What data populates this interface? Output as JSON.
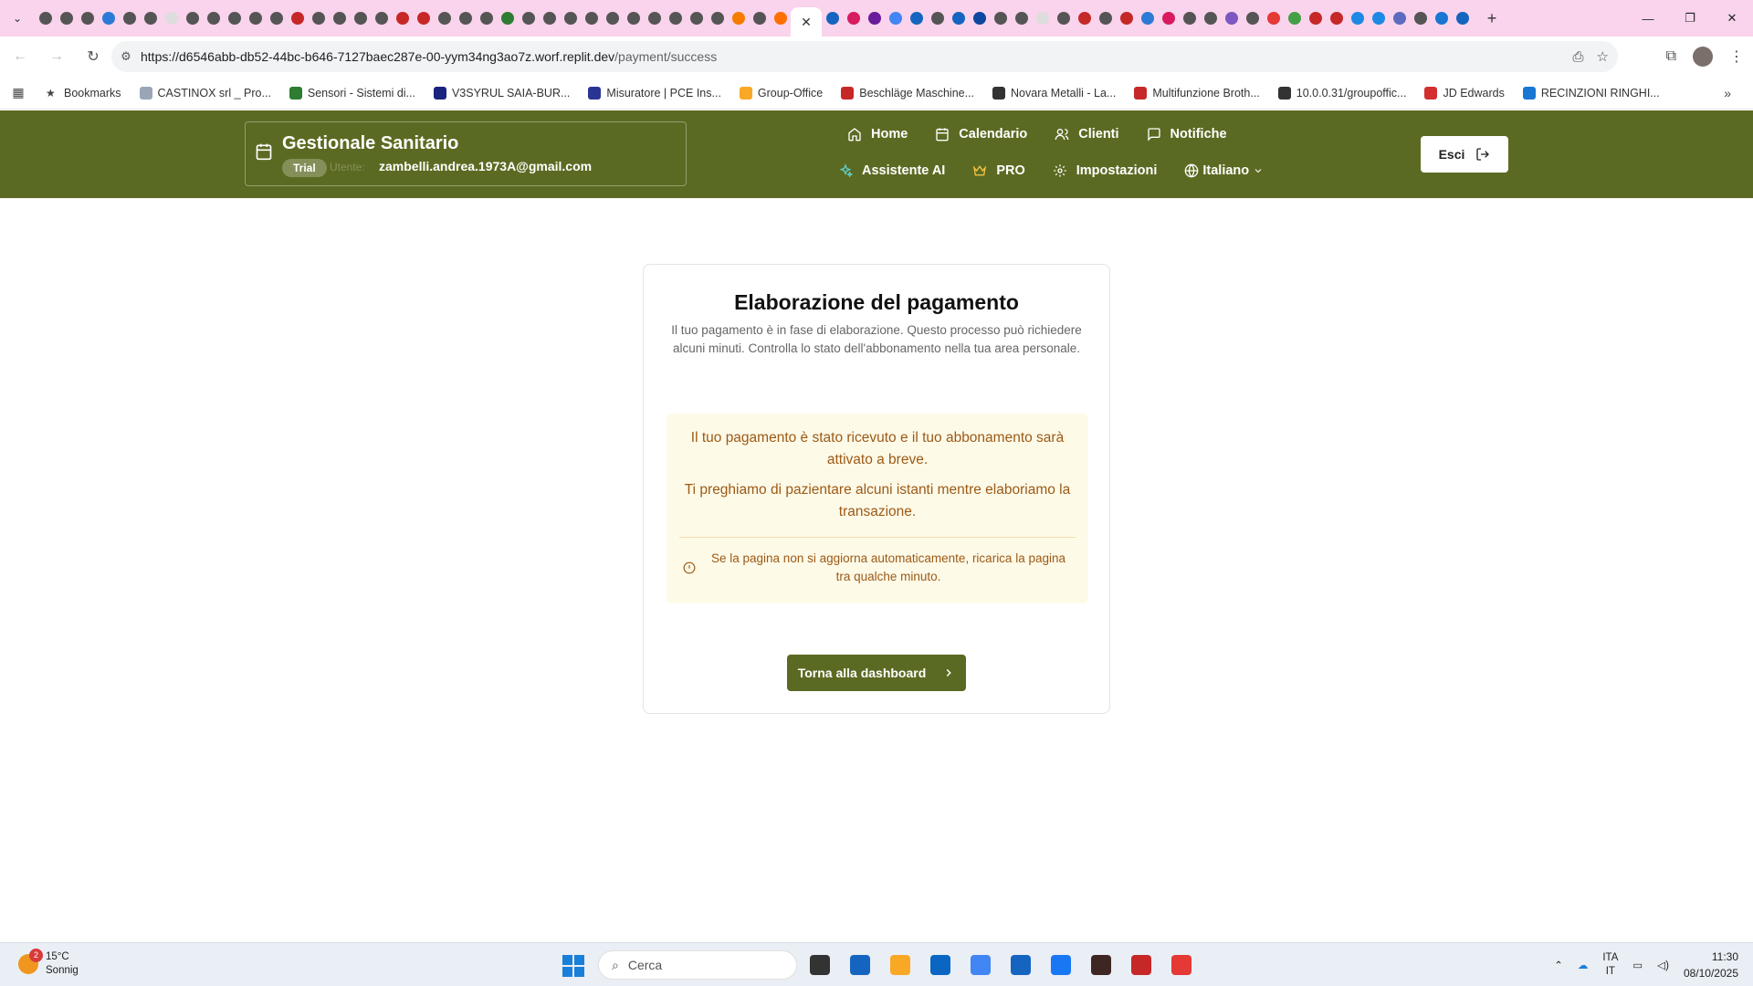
{
  "browser": {
    "tab_close_glyph": "✕",
    "new_tab_glyph": "+",
    "url_host": "https://d6546abb-db52-44bc-b646-7127baec287e-00-yym34ng3ao7z.worf.replit.dev",
    "url_path": "/payment/success",
    "tab_favicon_colors": [
      "#555",
      "#555",
      "#555",
      "#2b7bd6",
      "#555",
      "#555",
      "#ddd",
      "#555",
      "#555",
      "#555",
      "#555",
      "#555",
      "#c62828",
      "#555",
      "#555",
      "#555",
      "#555",
      "#c62828",
      "#c62828",
      "#555",
      "#555",
      "#555",
      "#2e7d32",
      "#555",
      "#555",
      "#555",
      "#555",
      "#555",
      "#555",
      "#555",
      "#555",
      "#555",
      "#555",
      "#f57c00",
      "#555",
      "#ff6f00"
    ],
    "tab_favicon_colors_after": [
      "#1565c0",
      "#d81b60",
      "#6a1b9a",
      "#4285f4",
      "#1565c0",
      "#555",
      "#1565c0",
      "#0d47a1",
      "#555",
      "#555",
      "#ddd",
      "#555",
      "#c62828",
      "#555",
      "#c62828",
      "#2b7bd6",
      "#d81b60",
      "#555",
      "#555",
      "#7e57c2",
      "#555",
      "#e53935",
      "#43a047",
      "#c62828",
      "#c62828",
      "#1e88e5",
      "#1e88e5",
      "#5c6bc0",
      "#555",
      "#1976d2",
      "#1565c0"
    ]
  },
  "bookmarks": [
    {
      "label": "Bookmarks",
      "color": "#444"
    },
    {
      "label": "CASTINOX srl _ Pro...",
      "color": "#9aa6b8"
    },
    {
      "label": "Sensori - Sistemi di...",
      "color": "#2e7d32"
    },
    {
      "label": "V3SYRUL SAIA-BUR...",
      "color": "#1a237e"
    },
    {
      "label": "Misuratore | PCE Ins...",
      "color": "#283593"
    },
    {
      "label": "Group-Office",
      "color": "#f9a825"
    },
    {
      "label": "Beschläge Maschine...",
      "color": "#c62828"
    },
    {
      "label": "Novara Metalli - La...",
      "color": "#333333"
    },
    {
      "label": "Multifunzione Broth...",
      "color": "#c62828"
    },
    {
      "label": "10.0.0.31/groupoffic...",
      "color": "#333333"
    },
    {
      "label": "JD Edwards",
      "color": "#d32f2f"
    },
    {
      "label": "RECINZIONI RINGHI...",
      "color": "#1976d2"
    }
  ],
  "header": {
    "brand_title": "Gestionale Sanitario",
    "trial_badge": "Trial",
    "plan_label": "Utente:",
    "email": "zambelli.andrea.1973A@gmail.com",
    "nav": {
      "home": "Home",
      "calendar": "Calendario",
      "clients": "Clienti",
      "notifications": "Notifiche",
      "ai_assistant": "Assistente AI",
      "pro": "PRO",
      "settings": "Impostazioni",
      "language": "Italiano"
    },
    "logout_label": "Esci",
    "bg_color": "#5b6a22"
  },
  "card": {
    "title": "Elaborazione del pagamento",
    "description": "Il tuo pagamento è in fase di elaborazione. Questo processo può richiedere alcuni minuti. Controlla lo stato dell'abbonamento nella tua area personale.",
    "notice_line1": "Il tuo pagamento è stato ricevuto e il tuo abbonamento sarà attivato a breve.",
    "notice_line2": "Ti preghiamo di pazientare alcuni istanti mentre elaboriamo la transazione.",
    "notice_warning": "Se la pagina non si aggiorna automaticamente, ricarica la pagina tra qualche minuto.",
    "dashboard_button": "Torna alla dashboard",
    "notice_color": "#9b5a16"
  },
  "taskbar": {
    "weather_temp": "15°C",
    "weather_cond": "Sonnig",
    "weather_badge": "2",
    "search_placeholder": "Cerca",
    "lang_top": "ITA",
    "lang_bottom": "IT",
    "time": "11:30",
    "date": "08/10/2025",
    "app_colors": [
      "#333333",
      "#1565c0",
      "#f9a825",
      "#0a66c2",
      "#4285f4",
      "#1565c0",
      "#1877f2",
      "#3e2723",
      "#c62828",
      "#e53935"
    ]
  }
}
